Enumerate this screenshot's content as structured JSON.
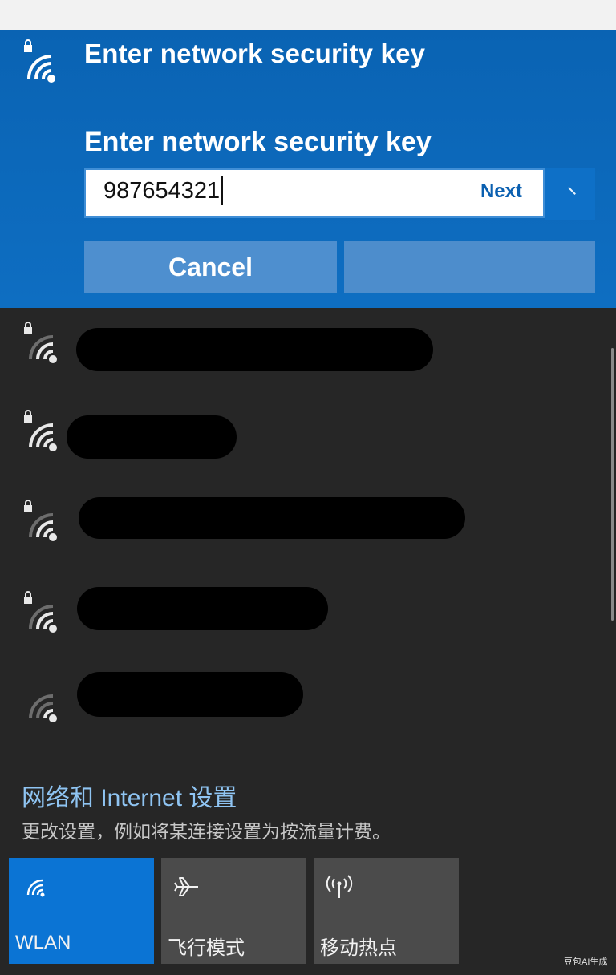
{
  "selected_network": {
    "title": "Enter network security key",
    "icon": "wifi-secured-icon",
    "key_label": "Enter network security key",
    "key_value": "987654321",
    "next_label": "Next",
    "cancel_label": "Cancel",
    "accent_color": "#0a63b3"
  },
  "networks": [
    {
      "icon": "wifi-secured-icon",
      "secured": true
    },
    {
      "icon": "wifi-secured-icon",
      "secured": true
    },
    {
      "icon": "wifi-secured-icon",
      "secured": true
    },
    {
      "icon": "wifi-secured-icon",
      "secured": true
    },
    {
      "icon": "wifi-open-icon",
      "secured": false
    }
  ],
  "settings": {
    "link": "网络和 Internet 设置",
    "description": "更改设置，例如将某连接设置为按流量计费。"
  },
  "quick_actions": [
    {
      "label": "WLAN",
      "icon": "wifi-icon",
      "active": true
    },
    {
      "label": "飞行模式",
      "icon": "airplane-icon",
      "active": false
    },
    {
      "label": "移动热点",
      "icon": "hotspot-icon",
      "active": false
    }
  ],
  "watermark": "豆包AI生成"
}
